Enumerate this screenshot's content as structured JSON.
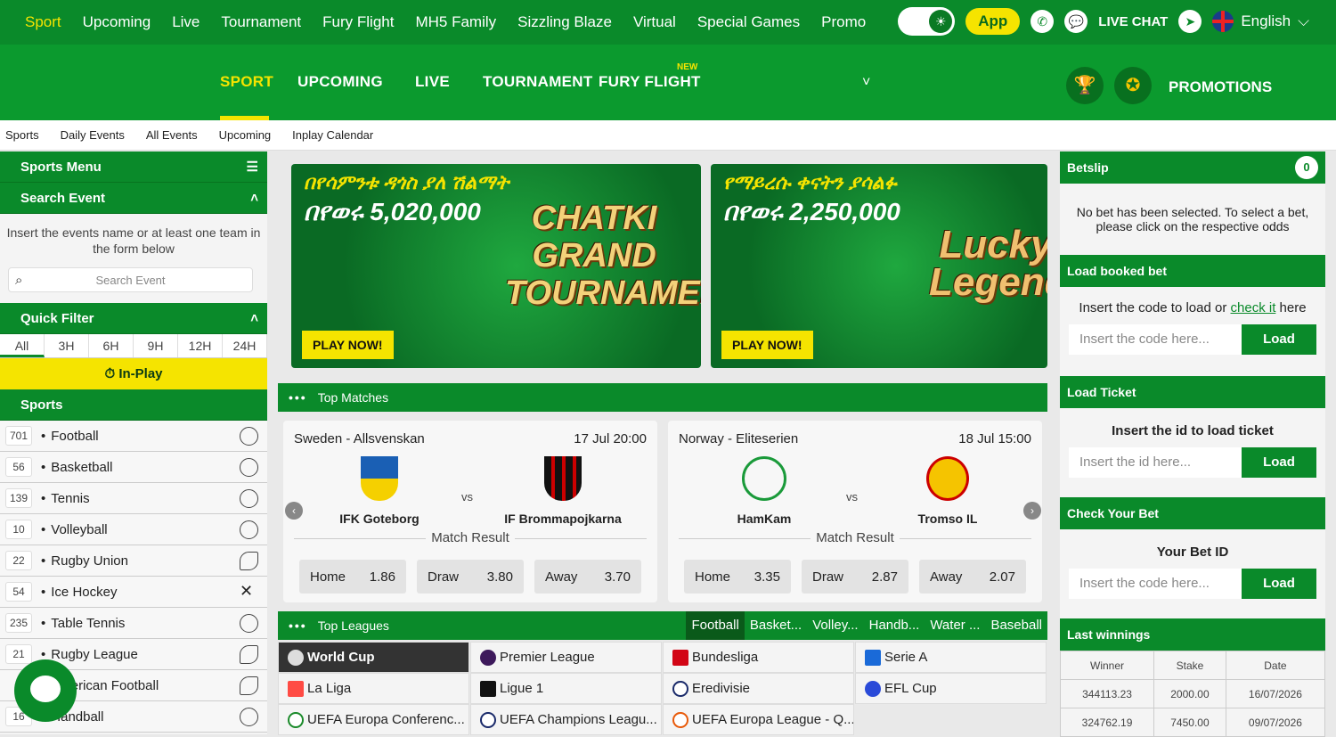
{
  "topnav": {
    "items": [
      "Sport",
      "Upcoming",
      "Live",
      "Tournament",
      "Fury Flight",
      "MH5 Family",
      "Sizzling Blaze",
      "Virtual",
      "Special Games",
      "Promo"
    ],
    "app_label": "App",
    "live_chat": "LIVE CHAT",
    "language": "English"
  },
  "mainnav": {
    "items": [
      "SPORT",
      "UPCOMING",
      "LIVE",
      "TOURNAMENT",
      "FURY FLIGHT"
    ],
    "new_tag": "NEW",
    "promotions": "PROMOTIONS"
  },
  "subnav": [
    "Sports",
    "Daily Events",
    "All Events",
    "Upcoming",
    "Inplay Calendar"
  ],
  "left": {
    "sports_menu": "Sports Menu",
    "search_event": "Search Event",
    "search_hint": "Insert the events name or at least one team in the form below",
    "search_placeholder": "Search Event",
    "quick_filter": "Quick Filter",
    "time_filters": [
      "All",
      "3H",
      "6H",
      "9H",
      "12H",
      "24H"
    ],
    "inplay": "In-Play",
    "sports_title": "Sports",
    "sports": [
      {
        "count": "701",
        "name": "Football"
      },
      {
        "count": "56",
        "name": "Basketball"
      },
      {
        "count": "139",
        "name": "Tennis"
      },
      {
        "count": "10",
        "name": "Volleyball"
      },
      {
        "count": "22",
        "name": "Rugby Union"
      },
      {
        "count": "54",
        "name": "Ice Hockey"
      },
      {
        "count": "235",
        "name": "Table Tennis"
      },
      {
        "count": "21",
        "name": "Rugby League"
      },
      {
        "count": "",
        "name": "American Football"
      },
      {
        "count": "16",
        "name": "Handball"
      }
    ]
  },
  "banners": [
    {
      "amharic": "በየሳምንቱ ዳጎስ ያለ ሽልማት",
      "amount": "በየወሩ 5,020,000",
      "logo": "CHATKI GRAND TOURNAMENT",
      "cta": "PLAY NOW!"
    },
    {
      "amharic": "የማይረሱ ቀናትን ያሳልፉ",
      "amount": "በየወሩ 2,250,000",
      "logo": "Lucky Legends",
      "cta": "PLAY NOW!"
    }
  ],
  "top_matches": {
    "title": "Top Matches",
    "matches": [
      {
        "league": "Sweden - Allsvenskan",
        "date": "17 Jul 20:00",
        "home": "IFK Goteborg",
        "away": "IF Brommapojkarna",
        "market": "Match Result",
        "odds": [
          {
            "label": "Home",
            "value": "1.86"
          },
          {
            "label": "Draw",
            "value": "3.80"
          },
          {
            "label": "Away",
            "value": "3.70"
          }
        ]
      },
      {
        "league": "Norway - Eliteserien",
        "date": "18 Jul 15:00",
        "home": "HamKam",
        "away": "Tromso IL",
        "market": "Match Result",
        "odds": [
          {
            "label": "Home",
            "value": "3.35"
          },
          {
            "label": "Draw",
            "value": "2.87"
          },
          {
            "label": "Away",
            "value": "2.07"
          }
        ]
      }
    ],
    "vs": "vs"
  },
  "top_leagues": {
    "title": "Top Leagues",
    "tabs": [
      "Football",
      "Basket...",
      "Volley...",
      "Handb...",
      "Water ...",
      "Baseball"
    ],
    "leagues": [
      "World Cup",
      "Premier League",
      "Bundesliga",
      "Serie A",
      "La Liga",
      "Ligue 1",
      "Eredivisie",
      "EFL Cup",
      "UEFA Europa Conferenc...",
      "UEFA Champions Leagu...",
      "UEFA Europa League - Q..."
    ]
  },
  "right": {
    "betslip": "Betslip",
    "betslip_count": "0",
    "no_bet": "No bet has been selected. To select a bet, please click on the respective odds",
    "load_booked": "Load booked bet",
    "load_text_pre": "Insert the code to load or",
    "load_text_link": "check it",
    "load_text_post": "here",
    "code_placeholder": "Insert the code here...",
    "load_btn": "Load",
    "load_ticket": "Load Ticket",
    "ticket_text": "Insert the id to load ticket",
    "id_placeholder": "Insert the id here...",
    "check_bet": "Check Your Bet",
    "bet_id_label": "Your Bet ID",
    "last_winnings": "Last winnings",
    "win_headers": [
      "Winner",
      "Stake",
      "Date"
    ],
    "win_rows": [
      [
        "344113.23",
        "2000.00",
        "16/07/2026"
      ],
      [
        "324762.19",
        "7450.00",
        "09/07/2026"
      ]
    ]
  }
}
